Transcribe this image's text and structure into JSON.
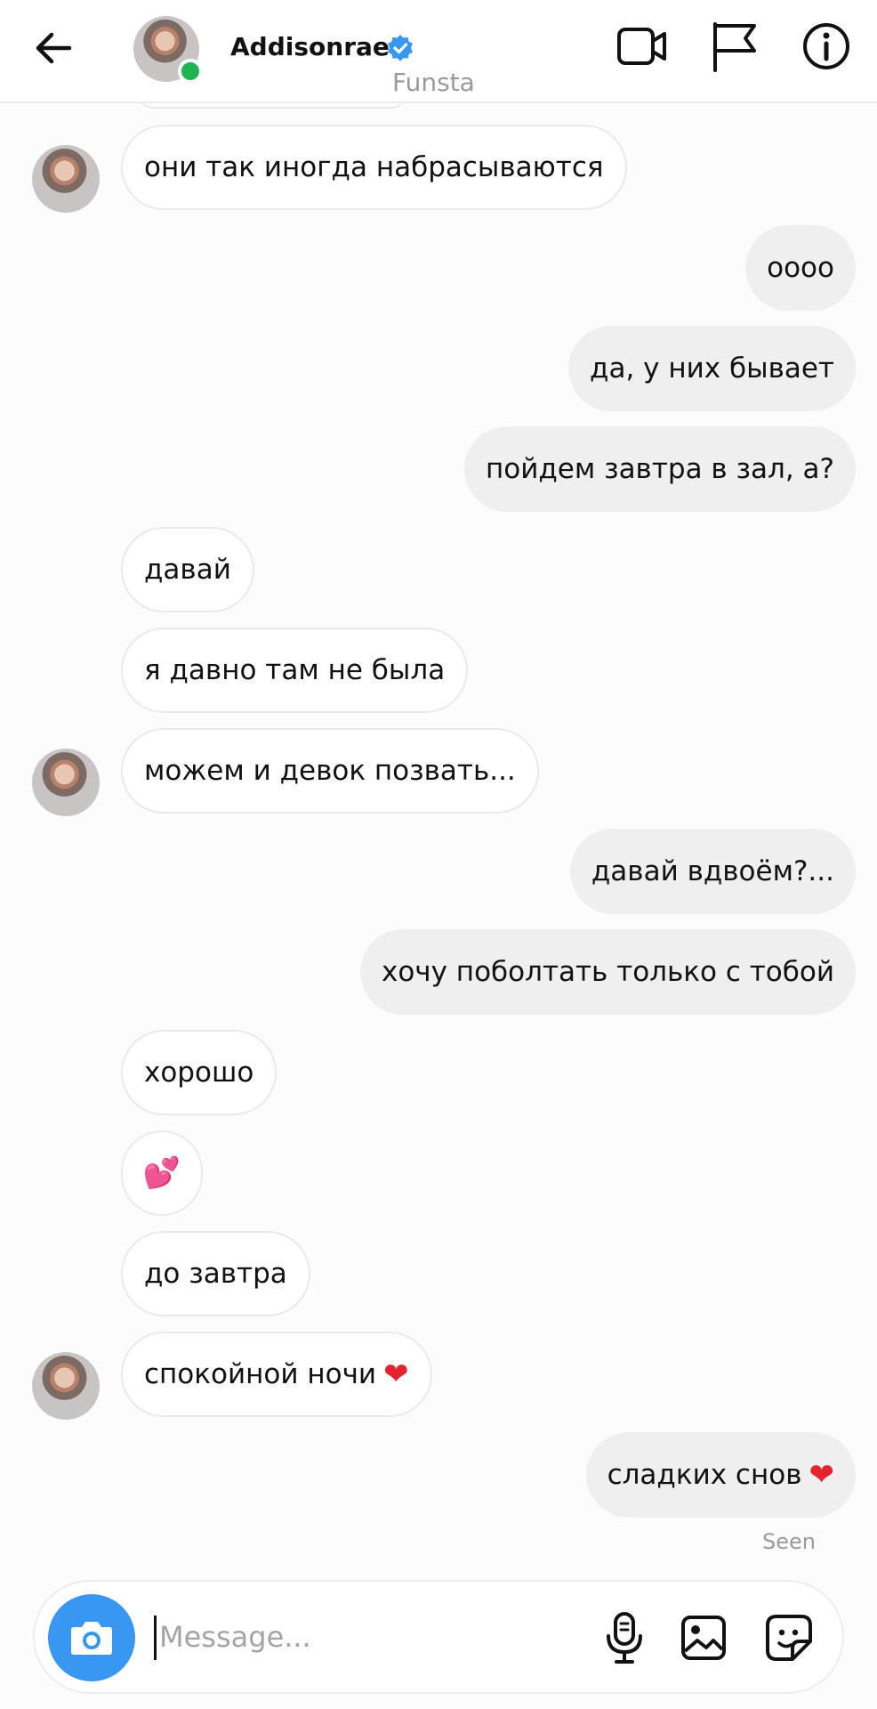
{
  "header": {
    "name": "Addisonrae",
    "subtitle": "Funsta",
    "verified": true,
    "online": true,
    "icons": [
      "back-arrow-icon",
      "video-call-icon",
      "flag-icon",
      "info-icon"
    ]
  },
  "messages": [
    {
      "side": "in",
      "text": "они так иногда набрасываются"
    },
    {
      "side": "out",
      "text": "оооо"
    },
    {
      "side": "out",
      "text": "да, у них бывает"
    },
    {
      "side": "out",
      "text": "пойдем завтра в зал, а?"
    },
    {
      "side": "in",
      "text": "давай"
    },
    {
      "side": "in",
      "text": "я давно там не была"
    },
    {
      "side": "in",
      "text": "можем и девок позвать..."
    },
    {
      "side": "out",
      "text": "давай вдвоём?..."
    },
    {
      "side": "out",
      "text": "хочу поболтать только с тобой"
    },
    {
      "side": "in",
      "text": "хорошо"
    },
    {
      "side": "in",
      "emoji": "💕"
    },
    {
      "side": "in",
      "text": "до завтра"
    },
    {
      "side": "in",
      "text": "спокойной ночи",
      "emoji": "❤"
    },
    {
      "side": "out",
      "text": "сладких снов",
      "emoji": "❤"
    }
  ],
  "status": "Seen",
  "composer": {
    "placeholder": "Message...",
    "icons": [
      "camera-icon",
      "microphone-icon",
      "gallery-icon",
      "sticker-icon"
    ]
  },
  "colors": {
    "accent": "#3897f0",
    "online": "#1fb351",
    "heart": "#e5232f",
    "outgoing_bubble": "#efefef"
  }
}
